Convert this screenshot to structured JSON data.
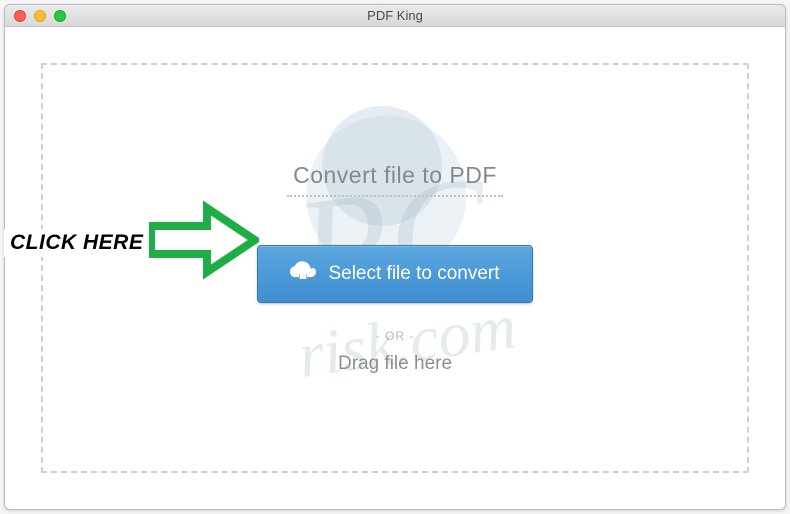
{
  "window": {
    "title": "PDF King"
  },
  "main": {
    "heading": "Convert file to PDF",
    "select_button_label": "Select file to convert",
    "or_label": "- OR -",
    "drag_label": "Drag file here"
  },
  "watermark": {
    "line1": "PC",
    "line2": "risk.com"
  },
  "annotation": {
    "label": "CLICK HERE"
  }
}
